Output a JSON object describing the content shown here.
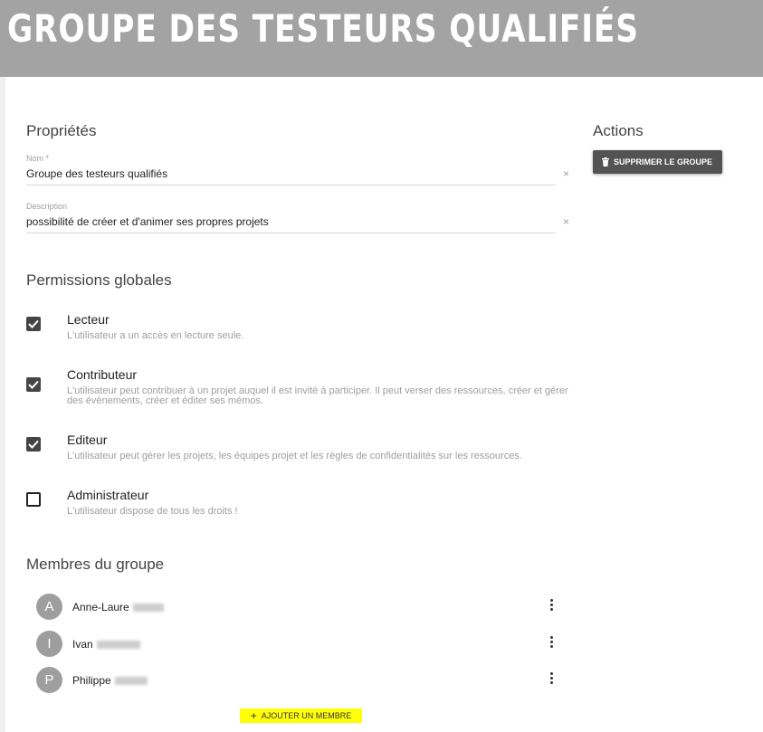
{
  "header": {
    "title": "GROUPE DES TESTEURS QUALIFIÉS"
  },
  "properties": {
    "section_title": "Propriétés",
    "name": {
      "label": "Nom *",
      "value": "Groupe des testeurs qualifiés"
    },
    "description": {
      "label": "Description",
      "value": "possibilité de créer et d'animer ses propres projets"
    },
    "clear_icon": "×"
  },
  "permissions": {
    "section_title": "Permissions globales",
    "items": [
      {
        "title": "Lecteur",
        "checked": true,
        "description": "L'utilisateur a un accès en lecture seule."
      },
      {
        "title": "Contributeur",
        "checked": true,
        "description": "L'utilisateur peut contribuer à un projet auquel il est invité à participer. Il peut verser des ressources, créer et gérer des évènements, créer et éditer ses mémos."
      },
      {
        "title": "Editeur",
        "checked": true,
        "description": "L'utilisateur peut gérer les projets, les équipes projet et les règles de confidentialités sur les ressources."
      },
      {
        "title": "Administrateur",
        "checked": false,
        "description": "L'utilisateur dispose de tous les droits !"
      }
    ]
  },
  "members": {
    "section_title": "Membres du groupe",
    "items": [
      {
        "initial": "A",
        "name": "Anne-Laure"
      },
      {
        "initial": "I",
        "name": "Ivan"
      },
      {
        "initial": "P",
        "name": "Philippe"
      }
    ],
    "add_label": "AJOUTER UN MEMBRE",
    "add_icon": "+",
    "add_highlight_color": "#ffff0a"
  },
  "actions": {
    "section_title": "Actions",
    "delete_label": "SUPPRIMER LE GROUPE",
    "delete_icon": "trash-icon"
  },
  "colors": {
    "header_bg": "#a3a3a3",
    "checkbox_checked": "#454545",
    "avatar_bg": "#9e9e9e",
    "button_bg": "#535353"
  }
}
